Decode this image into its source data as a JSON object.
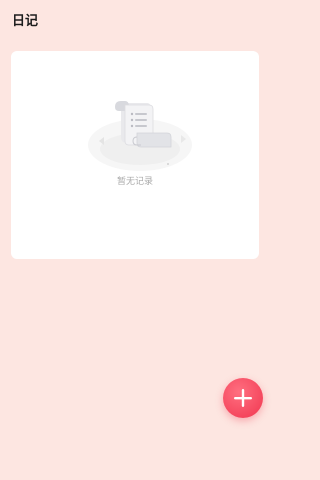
{
  "header": {
    "title": "日记"
  },
  "diary_list": {
    "entries": [],
    "empty_state": {
      "message": "暂无记录",
      "icon": "empty-scroll-icon"
    }
  },
  "fab": {
    "icon": "plus-icon",
    "color": "#f5475e"
  },
  "colors": {
    "background": "#fde6e1",
    "card": "#ffffff",
    "empty_text": "#a9a9a9"
  }
}
